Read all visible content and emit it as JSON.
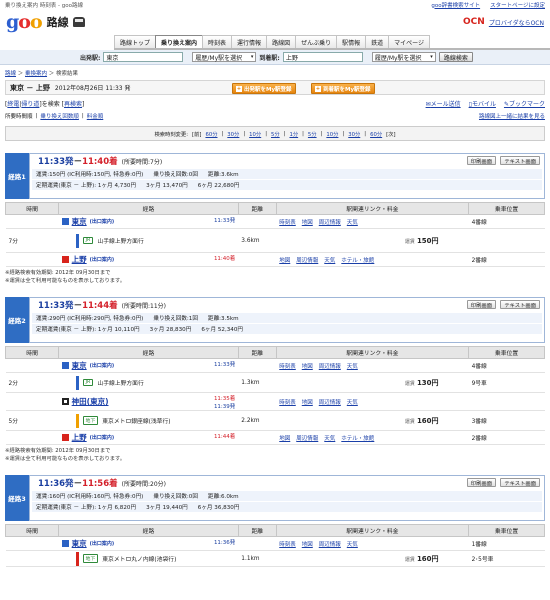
{
  "top": {
    "browser_title": "乗り換え案内 時刻表 - goo路線",
    "links": [
      "goo辞書検索サイト",
      "スタートページに設定"
    ]
  },
  "header": {
    "logo_g": "g",
    "logo_o1": "o",
    "logo_o2": "o",
    "service": "路線",
    "ocn_mark": "OCN",
    "ocn_text": "プロバイダならOCN"
  },
  "nav": [
    "路線トップ",
    "乗り換え案内",
    "時刻表",
    "運行情報",
    "路線図",
    "ぜんぶ乗り",
    "駅情報",
    "鉄道",
    "マイページ"
  ],
  "search": {
    "from_label": "出発駅:",
    "from_value": "東京",
    "from_select": "履歴/My駅を選択",
    "to_label": "到着駅:",
    "to_value": "上野",
    "to_select": "履歴/My駅を選択",
    "button": "路線検索"
  },
  "crumbs": {
    "home": "路線",
    "transfer": "乗換案内",
    "current": "検索結果"
  },
  "route_header": {
    "title": "東京 － 上野",
    "datetime": "2012年08月26日 11:33 発",
    "btn1": "出発駅をMy駅登録",
    "btn2": "到着駅をMy駅登録"
  },
  "actions": {
    "reverse": "終電",
    "return": "帰り道",
    "research_text": "を検索",
    "search_again": "再検索",
    "mail": "メール送信",
    "mobile": "モバイル",
    "bookmark": "ブックマーク"
  },
  "sort": {
    "time": "所要時間順",
    "transfer": "乗り換え回数順",
    "fare": "料金順",
    "map_link": "路線図上一緒に結果を見る"
  },
  "timebar": {
    "label": "検索時刻変更:",
    "items": [
      "[前]",
      "60分",
      "30分",
      "10分",
      "5分",
      "1分",
      "5分",
      "10分",
      "30分",
      "60分",
      "[次]"
    ]
  },
  "table_headers": [
    "時間",
    "経路",
    "距離",
    "駅関連リンク・料金",
    "乗車位置"
  ],
  "routes": [
    {
      "label": "経路1",
      "dep": "11:33発",
      "sep": " － ",
      "arr": "11:40着",
      "req": "(所要時間:7分)",
      "row1": [
        "運賃:150円 (IC利用時:150円, 特急券:0円)",
        "乗り換え回数:0回",
        "距離:3.6km"
      ],
      "row2": [
        "定期運賃(東京 － 上野): 1ヶ月 4,730円",
        "3ヶ月 13,470円",
        "6ヶ月 22,680円"
      ],
      "print": "印刷画面",
      "text": "テキスト画面",
      "steps": [
        {
          "station": "東京",
          "sub": "(出口案内)",
          "dep_time": "11:33発",
          "links": [
            "時刻表",
            "地図",
            "周辺情報",
            "天気"
          ],
          "pos": "4番線",
          "color": "b"
        },
        {
          "time": "7分",
          "mode": "JR",
          "line": "山手線上野方面行",
          "dist": "3.6km",
          "fare": "150円"
        },
        {
          "station": "上野",
          "sub": "(出口案内)",
          "arr_time": "11:40着",
          "links": [
            "地図",
            "周辺情報",
            "天気",
            "ホテル・旅館"
          ],
          "pos": "2番線",
          "color": "r"
        }
      ],
      "notes": [
        "※経路検索有効期間: 2012年 09月30日まで",
        "※運賃は全て利用可能なものを表示しております。"
      ]
    },
    {
      "label": "経路2",
      "dep": "11:33発",
      "sep": " － ",
      "arr": "11:44着",
      "req": "(所要時間:11分)",
      "row1": [
        "運賃:290円 (IC利用時:290円, 特急券:0円)",
        "乗り換え回数:1回",
        "距離:3.5km"
      ],
      "row2": [
        "定期運賃(東京 － 上野): 1ヶ月 10,110円",
        "3ヶ月 28,830円",
        "6ヶ月 52,340円"
      ],
      "print": "印刷画面",
      "text": "テキスト画面",
      "steps": [
        {
          "station": "東京",
          "sub": "(出口案内)",
          "dep_time": "11:33発",
          "links": [
            "時刻表",
            "地図",
            "周辺情報",
            "天気"
          ],
          "pos": "4番線",
          "color": "b"
        },
        {
          "time": "2分",
          "mode": "JR",
          "line": "山手線上野方面行",
          "dist": "1.3km",
          "fare": "130円",
          "pos": "9号車"
        },
        {
          "station": "神田(東京)",
          "sub": "",
          "arr_time": "11:35着",
          "dep_time": "11:39発",
          "links": [
            "時刻表",
            "地図",
            "周辺情報",
            "天気"
          ],
          "pos": "",
          "color": "w"
        },
        {
          "time": "5分",
          "mode": "地下",
          "line": "東京メトロ銀座線(浅草行)",
          "dist": "2.2km",
          "fare": "160円",
          "pos": "3番線"
        },
        {
          "station": "上野",
          "sub": "(出口案内)",
          "arr_time": "11:44着",
          "links": [
            "地図",
            "周辺情報",
            "天気",
            "ホテル・旅館"
          ],
          "pos": "2番線",
          "color": "r"
        }
      ],
      "notes": [
        "※経路検索有効期間: 2012年 09月30日まで",
        "※運賃は全て利用可能なものを表示しております。"
      ]
    },
    {
      "label": "経路3",
      "dep": "11:36発",
      "sep": " － ",
      "arr": "11:56着",
      "req": "(所要時間:20分)",
      "row1": [
        "運賃:160円 (IC利用時:160円, 特急券:0円)",
        "乗り換え回数:0回",
        "距離:6.0km"
      ],
      "row2": [
        "定期運賃(東京 － 上野): 1ヶ月 6,820円",
        "3ヶ月 19,440円",
        "6ヶ月 36,830円"
      ],
      "print": "印刷画面",
      "text": "テキスト画面",
      "steps": [
        {
          "station": "東京",
          "sub": "(出口案内)",
          "dep_time": "11:36発",
          "links": [
            "時刻表",
            "地図",
            "周辺情報",
            "天気"
          ],
          "pos": "1番線",
          "color": "b"
        },
        {
          "time": "",
          "mode": "地下",
          "line": "東京メトロ丸ノ内線(池袋行)",
          "dist": "1.1km",
          "fare": "160円",
          "pos": "2･5号車"
        }
      ]
    }
  ]
}
